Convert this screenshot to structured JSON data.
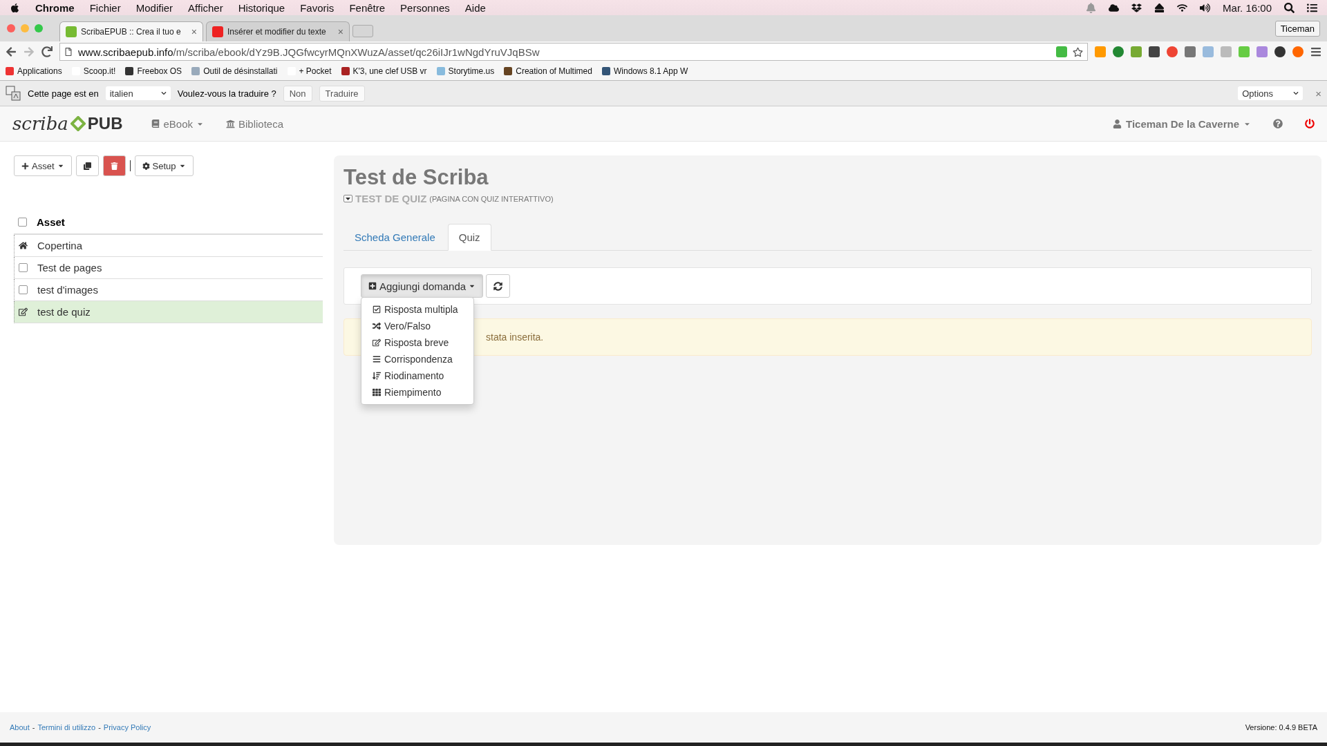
{
  "menubar": {
    "app_name": "Chrome",
    "items": [
      "Fichier",
      "Modifier",
      "Afficher",
      "Historique",
      "Favoris",
      "Fenêtre",
      "Personnes",
      "Aide"
    ],
    "clock": "Mar. 16:00"
  },
  "browser_tabs": [
    {
      "title": "ScribaEPUB :: Crea il tuo e",
      "selected": true,
      "close": "×"
    },
    {
      "title": "Insérer et modifier du texte",
      "selected": false,
      "close": "×"
    }
  ],
  "profile_button": "Ticeman",
  "address": {
    "host": "www.scribaepub.info",
    "path": "/m/scriba/ebook/dYz9B.JQGfwcyrMQnXWuzA/asset/qc26iIJr1wNgdYruVJqBSw"
  },
  "bookmarks": [
    "Applications",
    "Scoop.it!",
    "Freebox OS",
    "Outil de désinstallati",
    "+ Pocket",
    "K'3, une clef USB vr",
    "Storytime.us",
    "Creation of Multimed",
    "Windows 8.1 App W"
  ],
  "translate_bar": {
    "prompt": "Cette page est en",
    "language": "italien",
    "question": "Voulez-vous la traduire ?",
    "buttons": [
      "Non",
      "Traduire"
    ],
    "options": "Options",
    "close": "×"
  },
  "app_header": {
    "brand": "scriba",
    "brand_suffix": "PUB",
    "nav": [
      {
        "label": "eBook",
        "kind": "dropdown"
      },
      {
        "label": "Biblioteca",
        "kind": "link"
      }
    ],
    "user": "Ticeman De la Caverne"
  },
  "sidebar": {
    "toolbar": {
      "add": "Asset",
      "setup": "Setup"
    },
    "header": {
      "label": "Asset",
      "checked": false
    },
    "items": [
      {
        "label": "Copertina",
        "kind": "home",
        "selected": false
      },
      {
        "label": "Test de pages",
        "kind": "page",
        "selected": false
      },
      {
        "label": "test d'images",
        "kind": "page",
        "selected": false
      },
      {
        "label": "test de quiz",
        "kind": "quiz",
        "selected": true
      }
    ]
  },
  "main": {
    "title": "Test de Scriba",
    "subtitle": "TEST DE QUIZ",
    "subtitle_note": "(PAGINA CON QUIZ INTERATTIVO)",
    "tabs": [
      {
        "label": "Scheda Generale",
        "selected": false
      },
      {
        "label": "Quiz",
        "selected": true
      }
    ],
    "add_button": "Aggiungi domanda",
    "menu": [
      {
        "label": "Risposta multipla",
        "kind": "multiple"
      },
      {
        "label": "Vero/Falso",
        "kind": "truefalse"
      },
      {
        "label": "Risposta breve",
        "kind": "short"
      },
      {
        "label": "Corrispondenza",
        "kind": "matching"
      },
      {
        "label": "Riodinamento",
        "kind": "ordering"
      },
      {
        "label": "Riempimento",
        "kind": "fill"
      }
    ],
    "alert": "stata inserita."
  },
  "footer": {
    "links": [
      "About",
      "Termini di utilizzo",
      "Privacy Policy"
    ],
    "separator": "-",
    "version": "Versione: 0.4.9 BETA"
  }
}
